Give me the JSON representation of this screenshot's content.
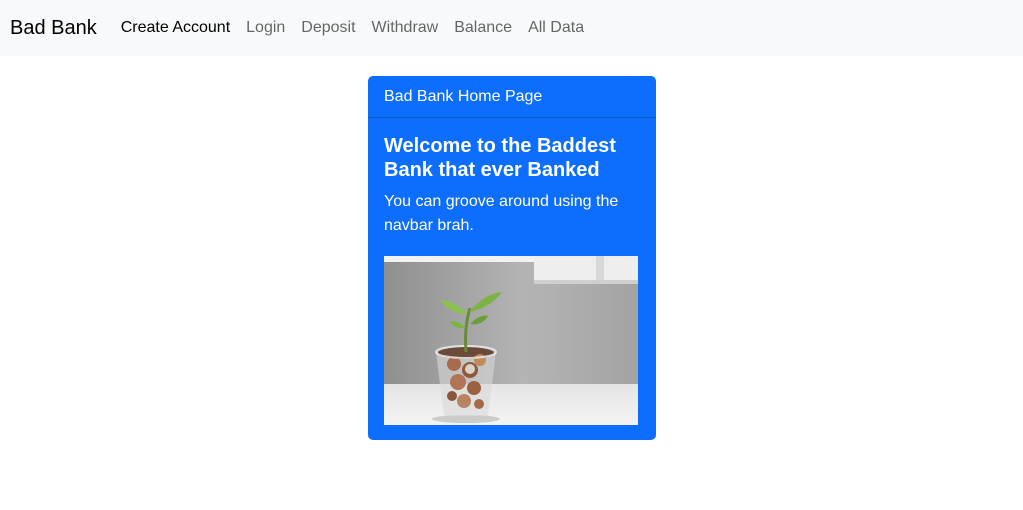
{
  "navbar": {
    "brand": "Bad Bank",
    "links": [
      {
        "label": "Create Account"
      },
      {
        "label": "Login"
      },
      {
        "label": "Deposit"
      },
      {
        "label": "Withdraw"
      },
      {
        "label": "Balance"
      },
      {
        "label": "All Data"
      }
    ]
  },
  "card": {
    "header": "Bad Bank Home Page",
    "title": "Welcome to the Baddest Bank that ever Banked",
    "text": "You can groove around using the navbar brah.",
    "image_alt": "plant-growing-from-coins-in-glass-image"
  },
  "colors": {
    "primary": "#0d6efd",
    "navbar_bg": "#f8f9fa"
  }
}
